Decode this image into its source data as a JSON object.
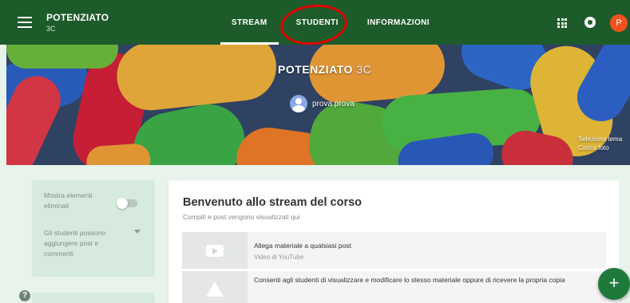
{
  "header": {
    "class_name": "POTENZIATO",
    "class_section": "3C",
    "tabs": [
      {
        "label": "STREAM",
        "active": true
      },
      {
        "label": "STUDENTI",
        "active": false
      },
      {
        "label": "INFORMAZIONI",
        "active": false
      }
    ],
    "avatar_letter": "P",
    "colors": {
      "bar": "#1e5b2a",
      "avatar": "#f4511e",
      "highlight": "#e30000"
    }
  },
  "banner": {
    "title": "POTENZIATO",
    "section": "3C",
    "teacher": "prova prova",
    "select_theme": [
      "Seleziona tema",
      "Carica foto"
    ]
  },
  "settings": {
    "show_deleted": "Mostra elementi eliminati",
    "students_can": "Gli studenti possono aggiungere post e commenti"
  },
  "stream": {
    "title": "Benvenuto allo stream del corso",
    "subtitle": "Compiti e post vengono visualizzati qui",
    "tips": [
      {
        "text": "Allega materiale a qualsiasi post",
        "source": "Video di YouTube",
        "icon": "youtube-icon"
      },
      {
        "text": "Consenti agli studenti di visualizzare e modificare lo stesso materiale oppure di ricevere la propria copia",
        "icon": "drive-icon"
      }
    ]
  },
  "fab": {
    "label": "+"
  },
  "help": {
    "label": "?"
  }
}
